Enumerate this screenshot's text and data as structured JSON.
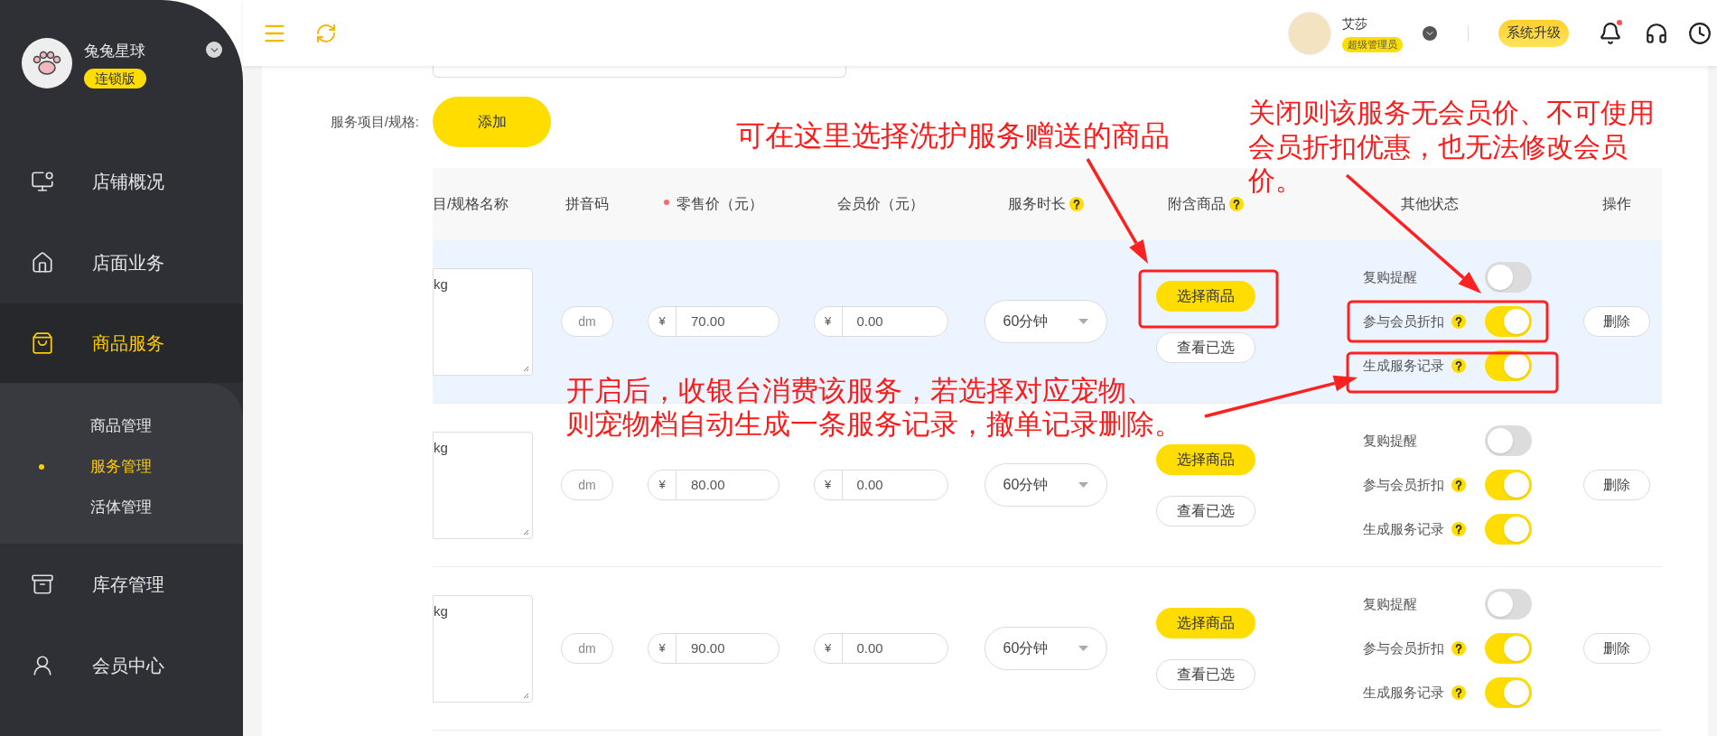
{
  "sidebar": {
    "store_name": "兔兔星球",
    "edition": "连锁版",
    "menu": [
      {
        "label": "店铺概况",
        "selected": false
      },
      {
        "label": "店面业务",
        "selected": false
      },
      {
        "label": "商品服务",
        "selected": true,
        "children": [
          {
            "label": "商品管理",
            "selected": false
          },
          {
            "label": "服务管理",
            "selected": true
          },
          {
            "label": "活体管理",
            "selected": false
          }
        ]
      },
      {
        "label": "库存管理",
        "selected": false
      },
      {
        "label": "会员中心",
        "selected": false
      }
    ]
  },
  "topbar": {
    "user_name": "艾莎",
    "role": "超级管理员",
    "upgrade_button": "系统升级",
    "has_notification": true
  },
  "form": {
    "label": "服务项目/规格:",
    "add_button": "添加"
  },
  "table": {
    "columns": [
      {
        "label": "目/规格名称",
        "required": false,
        "help": false
      },
      {
        "label": "拼音码",
        "required": false,
        "help": false
      },
      {
        "label": "零售价（元）",
        "required": true,
        "help": false
      },
      {
        "label": "会员价（元）",
        "required": false,
        "help": false
      },
      {
        "label": "服务时长",
        "required": false,
        "help": true
      },
      {
        "label": "附含商品",
        "required": false,
        "help": true
      },
      {
        "label": "其他状态",
        "required": false,
        "help": false
      },
      {
        "label": "操作",
        "required": false,
        "help": false
      }
    ],
    "rows": [
      {
        "selected": true,
        "name": "kg",
        "pinyin": "dm",
        "retail_currency": "¥",
        "retail": "70.00",
        "member_currency": "¥",
        "member": "0.00",
        "duration": "60分钟",
        "pick_button": "选择商品",
        "view_button": "查看已选",
        "statuses": [
          {
            "label": "复购提醒",
            "help": false,
            "on": false
          },
          {
            "label": "参与会员折扣",
            "help": true,
            "on": true
          },
          {
            "label": "生成服务记录",
            "help": true,
            "on": true
          }
        ],
        "delete_button": "删除"
      },
      {
        "selected": false,
        "name": "kg",
        "pinyin": "dm",
        "retail_currency": "¥",
        "retail": "80.00",
        "member_currency": "¥",
        "member": "0.00",
        "duration": "60分钟",
        "pick_button": "选择商品",
        "view_button": "查看已选",
        "statuses": [
          {
            "label": "复购提醒",
            "help": false,
            "on": false
          },
          {
            "label": "参与会员折扣",
            "help": true,
            "on": true
          },
          {
            "label": "生成服务记录",
            "help": true,
            "on": true
          }
        ],
        "delete_button": "删除"
      },
      {
        "selected": false,
        "name": "kg",
        "pinyin": "dm",
        "retail_currency": "¥",
        "retail": "90.00",
        "member_currency": "¥",
        "member": "0.00",
        "duration": "60分钟",
        "pick_button": "选择商品",
        "view_button": "查看已选",
        "statuses": [
          {
            "label": "复购提醒",
            "help": false,
            "on": false
          },
          {
            "label": "参与会员折扣",
            "help": true,
            "on": true
          },
          {
            "label": "生成服务记录",
            "help": true,
            "on": true
          }
        ],
        "delete_button": "删除"
      }
    ]
  },
  "annotations": [
    {
      "text": "可在这里选择洗护服务赠送的商品"
    },
    {
      "text": "关闭则该服务无会员价、不可使用会员折扣优惠，也无法修改会员价。"
    },
    {
      "text": "开启后，收银台消费该服务，若选择对应宠物、则宠物档自动生成一条服务记录，撤单记录删除。"
    }
  ]
}
